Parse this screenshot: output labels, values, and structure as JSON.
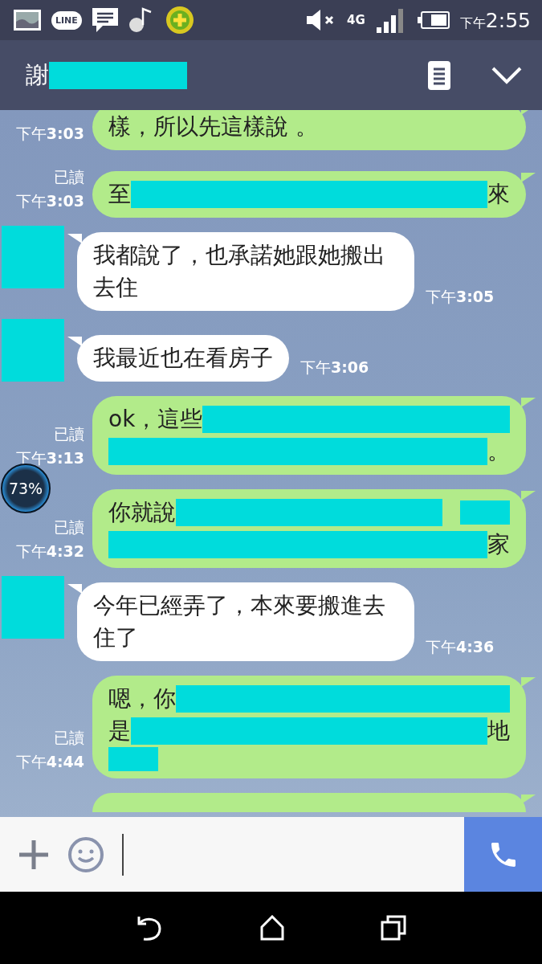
{
  "status_bar": {
    "app_icons": [
      {
        "kind": "gallery"
      },
      {
        "kind": "line",
        "label": "LINE"
      },
      {
        "kind": "message"
      },
      {
        "kind": "music"
      },
      {
        "kind": "plus"
      }
    ],
    "network_label": "4G",
    "time": "下午2:55"
  },
  "header": {
    "title": "謝",
    "title_redacted": true
  },
  "messages": [
    {
      "kind": "sent",
      "time": "下午**3:03**",
      "lines": [
        [
          {
            "kind": "text",
            "text": "樣，所以先這樣說 。"
          }
        ]
      ]
    },
    {
      "kind": "sent",
      "read": "已讀",
      "time": "下午**3:03**",
      "lines": [
        [
          {
            "kind": "text",
            "text": "至"
          },
          {
            "kind": "redaction"
          },
          {
            "kind": "text",
            "text": "來"
          }
        ]
      ]
    },
    {
      "kind": "received",
      "time": "下午**3:05**",
      "lines": [
        [
          {
            "kind": "text",
            "text": "我都說了，也承諾她跟她搬出去住"
          }
        ]
      ]
    },
    {
      "kind": "received",
      "time": "下午**3:06**",
      "lines": [
        [
          {
            "kind": "text",
            "text": "我最近也在看房子"
          }
        ]
      ]
    },
    {
      "kind": "sent",
      "read": "已讀",
      "time": "下午**3:13**",
      "lines": [
        [
          {
            "kind": "text",
            "text": "ok，這些"
          },
          {
            "kind": "redaction"
          }
        ],
        [
          {
            "kind": "redaction"
          },
          {
            "kind": "text",
            "text": "。"
          }
        ]
      ]
    },
    {
      "kind": "sent",
      "read": "已讀",
      "time": "下午**4:32**",
      "lines": [
        [
          {
            "kind": "text",
            "text": "你就說"
          },
          {
            "kind": "redaction"
          },
          {
            "kind": "gap"
          },
          {
            "kind": "redaction_short"
          }
        ],
        [
          {
            "kind": "redaction"
          },
          {
            "kind": "text",
            "text": "家"
          }
        ]
      ]
    },
    {
      "kind": "received",
      "time": "下午**4:36**",
      "lines": [
        [
          {
            "kind": "text",
            "text": "今年已經弄了，本來要搬進去住了"
          }
        ]
      ]
    },
    {
      "kind": "sent",
      "read": "已讀",
      "time": "下午**4:44**",
      "lines": [
        [
          {
            "kind": "text",
            "text": "嗯，你"
          },
          {
            "kind": "redaction"
          }
        ],
        [
          {
            "kind": "text",
            "text": "是"
          },
          {
            "kind": "redaction"
          },
          {
            "kind": "text",
            "text": "地"
          }
        ],
        [
          {
            "kind": "redaction_short"
          }
        ]
      ]
    },
    {
      "kind": "sent_partial"
    }
  ],
  "floating_widget": {
    "text": "73%"
  }
}
